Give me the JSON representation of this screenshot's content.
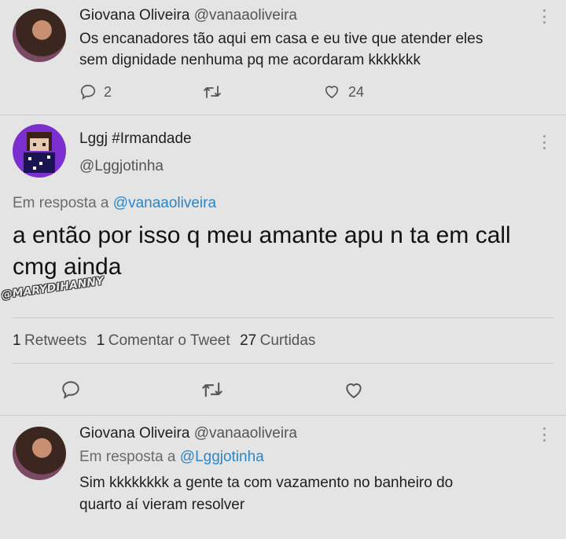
{
  "tweet1": {
    "name": "Giovana Oliveira",
    "handle": "@vanaaoliveira",
    "text_line1": "Os encanadores tão aqui em casa e eu tive que atender eles",
    "text_line2": "sem dignidade nenhuma pq me acordaram kkkkkkk",
    "reply_count": "2",
    "like_count": "24"
  },
  "tweet2": {
    "name": "Lggj #Irmandade",
    "handle": "@Lggjotinha",
    "reply_prefix": "Em resposta a",
    "reply_to": "@vanaaoliveira",
    "text_line1": "a então por isso q meu amante apu n ta em call",
    "text_line2": "cmg ainda",
    "watermark": "@MARYDIHANNY",
    "retweets_num": "1",
    "retweets_label": "Retweets",
    "comments_num": "1",
    "comments_label": "Comentar o Tweet",
    "likes_num": "27",
    "likes_label": "Curtidas"
  },
  "tweet3": {
    "name": "Giovana Oliveira",
    "handle": "@vanaaoliveira",
    "reply_prefix": "Em resposta a",
    "reply_to": "@Lggjotinha",
    "text_line1": "Sim kkkkkkkk a gente ta com vazamento no banheiro do",
    "text_line2": "quarto aí vieram resolver"
  },
  "icons": {
    "reply": "speech-bubble-icon",
    "retweet": "retweet-arrows-icon",
    "like": "heart-icon",
    "more": "vertical-dots-icon"
  },
  "colors": {
    "background": "#e4e4e4",
    "link": "#2a86c9",
    "avatar_lggj": "#7b2fd0"
  }
}
